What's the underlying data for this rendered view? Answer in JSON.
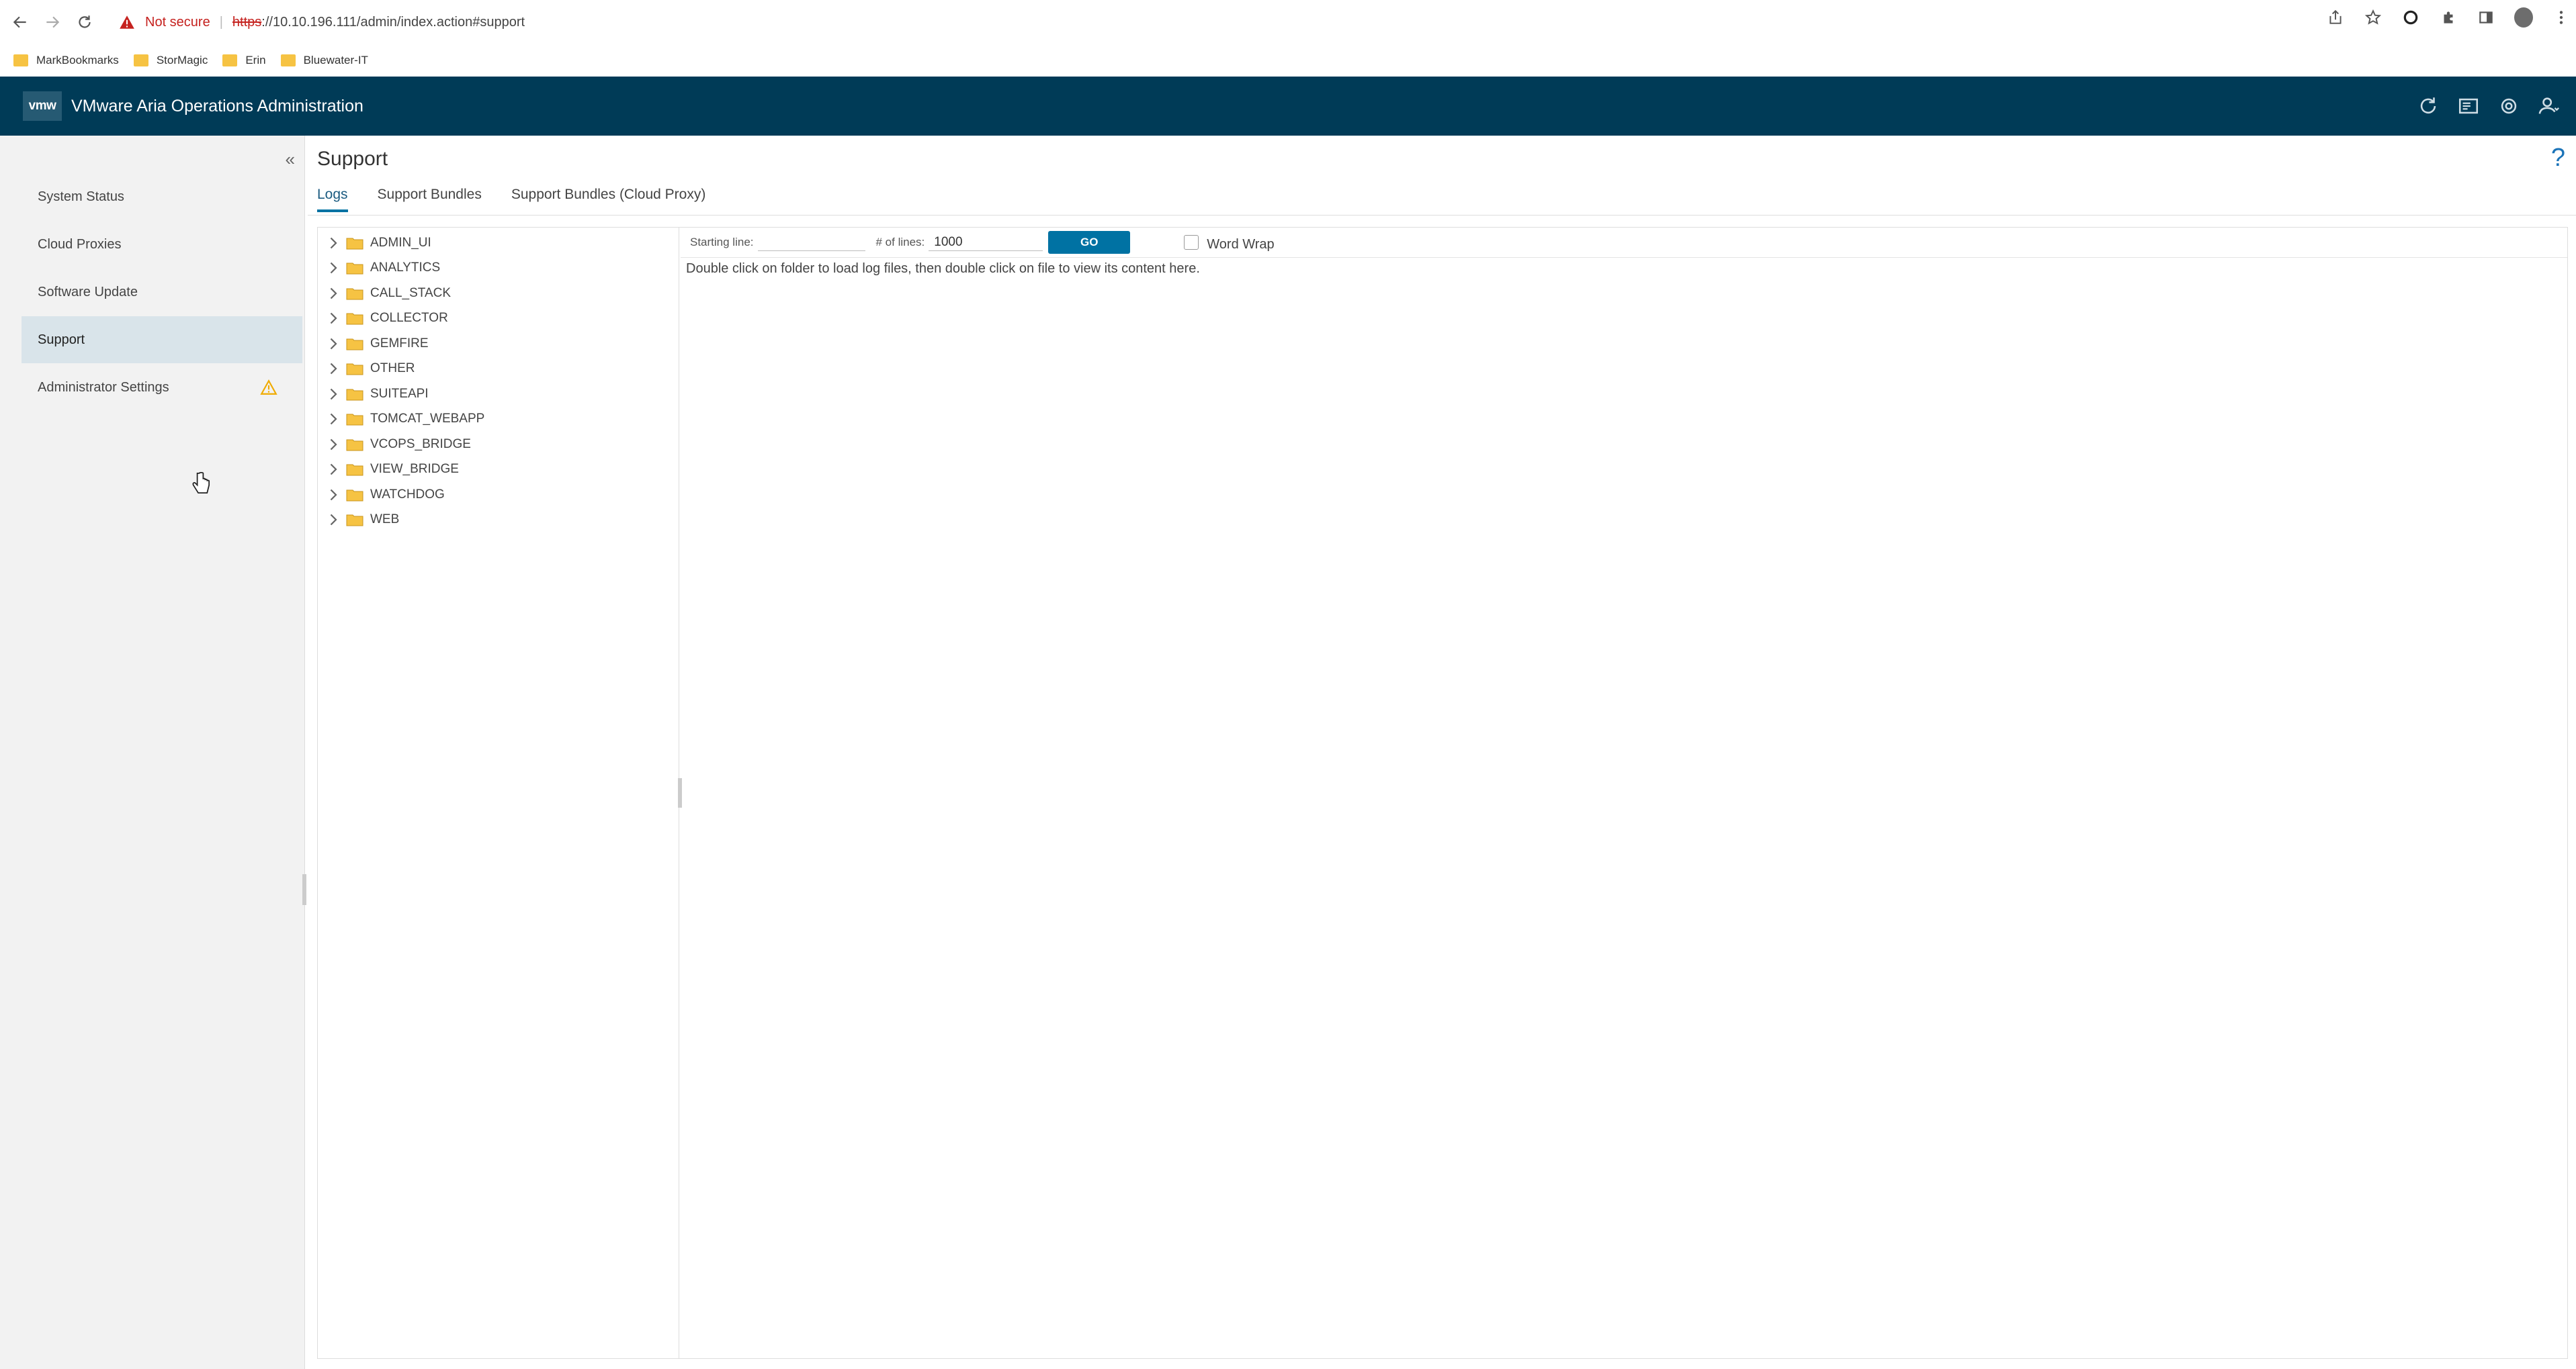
{
  "browser": {
    "not_secure": "Not secure",
    "url_scheme": "https",
    "url_rest": "://10.10.196.111/admin/index.action#support"
  },
  "bookmarks": [
    {
      "label": "MarkBookmarks"
    },
    {
      "label": "StorMagic"
    },
    {
      "label": "Erin"
    },
    {
      "label": "Bluewater-IT"
    }
  ],
  "app": {
    "logo": "vmw",
    "title": "VMware Aria Operations Administration"
  },
  "sidebar": {
    "collapse": "«",
    "items": [
      {
        "label": "System Status"
      },
      {
        "label": "Cloud Proxies"
      },
      {
        "label": "Software Update"
      },
      {
        "label": "Support",
        "active": true
      },
      {
        "label": "Administrator Settings",
        "warning": true
      }
    ]
  },
  "main": {
    "title": "Support",
    "help": "?",
    "tabs": [
      {
        "label": "Logs",
        "active": true
      },
      {
        "label": "Support Bundles"
      },
      {
        "label": "Support Bundles (Cloud Proxy)"
      }
    ],
    "tree": [
      "ADMIN_UI",
      "ANALYTICS",
      "CALL_STACK",
      "COLLECTOR",
      "GEMFIRE",
      "OTHER",
      "SUITEAPI",
      "TOMCAT_WEBAPP",
      "VCOPS_BRIDGE",
      "VIEW_BRIDGE",
      "WATCHDOG",
      "WEB"
    ],
    "viewer": {
      "starting_line_label": "Starting line:",
      "starting_line_value": "",
      "lines_label": "# of lines:",
      "lines_value": "1000",
      "go_label": "GO",
      "word_wrap_label": "Word Wrap",
      "word_wrap_checked": false,
      "hint": "Double click on folder to load log files, then double click on file to view its content here."
    }
  },
  "colors": {
    "header_bg": "#003b57",
    "accent": "#0072a3",
    "warning": "#f0ab00",
    "folder": "#f6c343"
  }
}
